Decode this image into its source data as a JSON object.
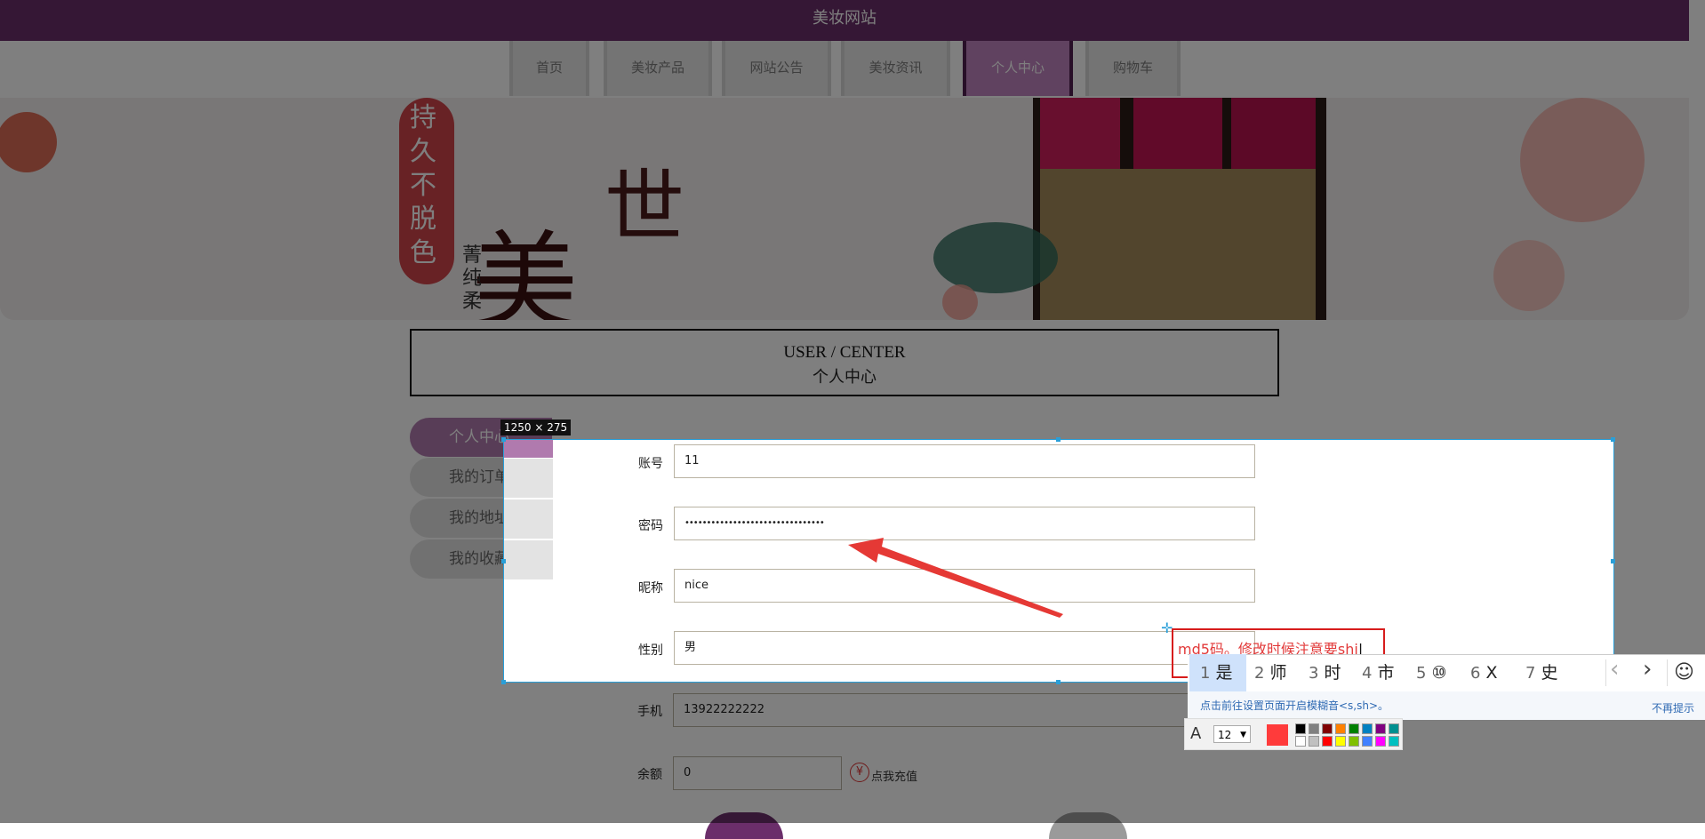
{
  "site": {
    "title": "美妆网站"
  },
  "nav": [
    "首页",
    "美妆产品",
    "网站公告",
    "美妆资讯",
    "个人中心",
    "购物车"
  ],
  "banner": {
    "text_1": "持久不脱色",
    "text_2": "世",
    "text_3": "美",
    "text_4": "菁纯柔"
  },
  "header": {
    "en": "USER / CENTER",
    "cn": "个人中心"
  },
  "sidebar": [
    "个人中心",
    "我的订单",
    "我的地址",
    "我的收藏"
  ],
  "form": {
    "account_label": "账号",
    "account_value": "11",
    "password_label": "密码",
    "password_value": "••••••••••••••••••••••••••••••••",
    "nickname_label": "昵称",
    "nickname_value": "nice",
    "gender_label": "性别",
    "gender_value": "男",
    "phone_label": "手机",
    "phone_value": "13922222222",
    "balance_label": "余额",
    "balance_value": "0",
    "recharge": "点我充值",
    "yen": "¥"
  },
  "screenshot": {
    "size_badge": "1250 × 275"
  },
  "annotation": {
    "text": "md5码。修改时候注意要shi"
  },
  "ime": {
    "candidates": [
      "1",
      "是",
      "2",
      "师",
      "3",
      "时",
      "4",
      "市",
      "5",
      "⑩",
      "6",
      "X",
      "7",
      "史"
    ],
    "tip": "点击前往设置页面开启模糊音<s,sh>。",
    "dismiss": "不再提示",
    "prev": "‹",
    "next": "›",
    "emoji": "☺"
  },
  "palette": {
    "font_glyph": "A",
    "font_size": "12",
    "current_color": "#ff3b3b",
    "colors": [
      "#000000",
      "#808080",
      "#800000",
      "#ff8000",
      "#008000",
      "#0080c0",
      "#800080",
      "#009090",
      "#ffffff",
      "#c0c0c0",
      "#ff0000",
      "#ffff00",
      "#80c000",
      "#4080ff",
      "#ff00ff",
      "#00c0c0"
    ]
  }
}
